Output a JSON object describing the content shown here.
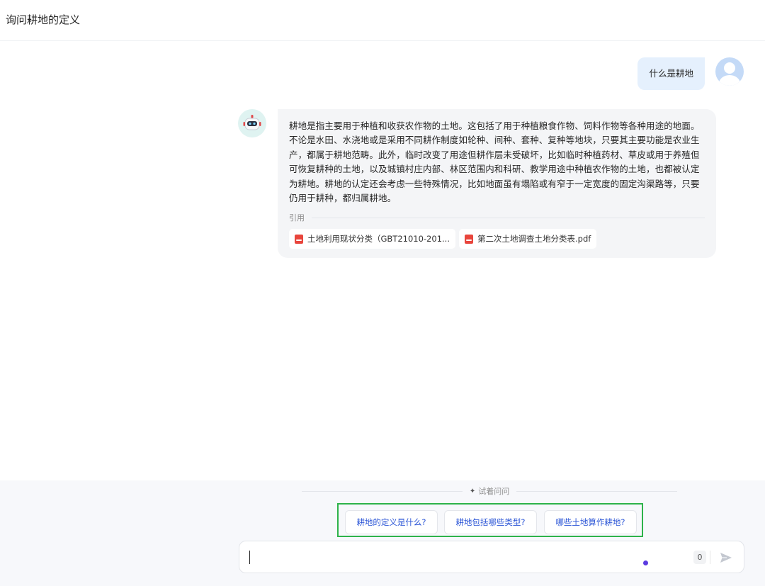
{
  "header": {
    "title": "询问耕地的定义"
  },
  "messages": {
    "user": {
      "text": "什么是耕地"
    },
    "bot": {
      "text": "耕地是指主要用于种植和收获农作物的土地。这包括了用于种植粮食作物、饲料作物等各种用途的地面。不论是水田、水浇地或是采用不同耕作制度如轮种、间种、套种、复种等地块，只要其主要功能是农业生产，都属于耕地范畴。此外，临时改变了用途但耕作层未受破坏，比如临时种植药材、草皮或用于养殖但可恢复耕种的土地，以及城镇村庄内部、林区范围内和科研、教学用途中种植农作物的土地，也都被认定为耕地。耕地的认定还会考虑一些特殊情况，比如地面虽有塌陷或有窄于一定宽度的固定沟渠路等，只要仍用于耕种，都归属耕地。",
      "citations_label": "引用",
      "citations": [
        {
          "name": "土地利用现状分类（GBT21010-201...",
          "icon": "pdf-icon"
        },
        {
          "name": "第二次土地调查土地分类表.pdf",
          "icon": "pdf-icon"
        }
      ]
    }
  },
  "suggestions": {
    "label": "试着问问",
    "items": [
      "耕地的定义是什么?",
      "耕地包括哪些类型?",
      "哪些土地算作耕地?"
    ]
  },
  "input": {
    "value": "",
    "char_count": "0"
  },
  "colors": {
    "accent": "#2b55d6",
    "highlight_box": "#2eb34a",
    "user_bubble": "#e5f0fd",
    "bot_bubble": "#f4f5f7"
  }
}
